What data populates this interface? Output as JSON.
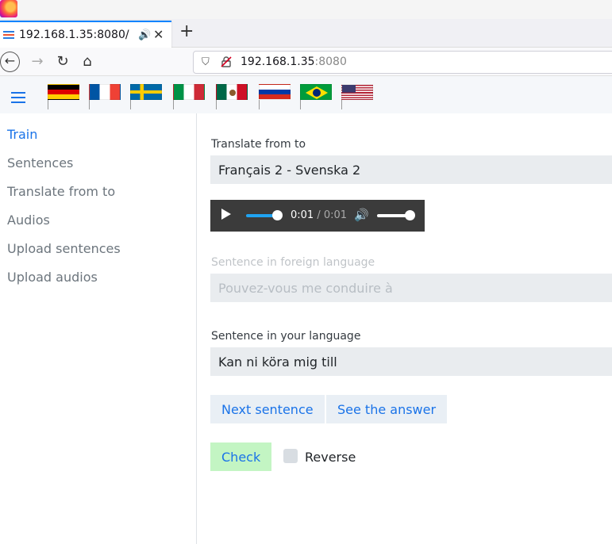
{
  "browser": {
    "tab_title": "192.168.1.35:8080/",
    "url_host": "192.168.1.35",
    "url_port": ":8080",
    "new_tab_label": "+"
  },
  "flags": [
    "germany-flag",
    "france-flag",
    "sweden-flag",
    "italy-flag",
    "mexico-flag",
    "russia-flag",
    "brazil-flag",
    "usa-flag"
  ],
  "sidebar": {
    "items": [
      {
        "label": "Train",
        "active": true
      },
      {
        "label": "Sentences",
        "active": false
      },
      {
        "label": "Translate from to",
        "active": false
      },
      {
        "label": "Audios",
        "active": false
      },
      {
        "label": "Upload sentences",
        "active": false
      },
      {
        "label": "Upload audios",
        "active": false
      }
    ]
  },
  "main": {
    "translate_label": "Translate from to",
    "translate_value": "Français 2 - Svenska 2",
    "audio": {
      "current": "0:01",
      "separator": " / ",
      "total": "0:01"
    },
    "foreign_label": "Sentence in foreign language",
    "foreign_placeholder": "Pouvez-vous me conduire à",
    "native_label": "Sentence in your language",
    "native_value": "Kan ni köra mig till",
    "next_button": "Next sentence",
    "answer_button": "See the answer",
    "check_button": "Check",
    "reverse_label": "Reverse"
  },
  "colors": {
    "accent": "#1a73e8",
    "check_button_bg": "#c3f5c3",
    "audio_bg": "#3b3b3b"
  }
}
